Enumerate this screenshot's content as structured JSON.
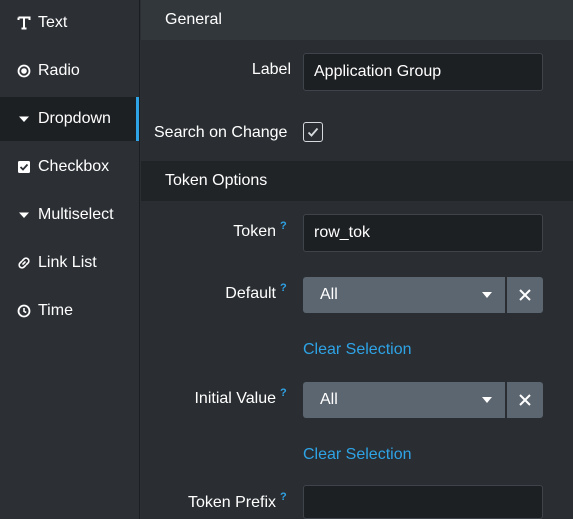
{
  "sidebar": {
    "items": [
      {
        "label": "Text",
        "icon": "text-icon"
      },
      {
        "label": "Radio",
        "icon": "radio-icon"
      },
      {
        "label": "Dropdown",
        "icon": "dropdown-icon",
        "active": true
      },
      {
        "label": "Checkbox",
        "icon": "checkbox-icon"
      },
      {
        "label": "Multiselect",
        "icon": "multiselect-icon"
      },
      {
        "label": "Link List",
        "icon": "link-icon"
      },
      {
        "label": "Time",
        "icon": "clock-icon"
      }
    ]
  },
  "general": {
    "header": "General",
    "label_label": "Label",
    "label_value": "Application Group",
    "search_on_change_label": "Search on Change",
    "search_on_change_checked": true
  },
  "token_options": {
    "header": "Token Options",
    "token_label": "Token",
    "token_value": "row_tok",
    "default_label": "Default",
    "default_value": "All",
    "default_clear": "Clear Selection",
    "initial_label": "Initial Value",
    "initial_value": "All",
    "initial_clear": "Clear Selection",
    "prefix_label": "Token Prefix",
    "prefix_value": "",
    "help_mark": "?"
  },
  "colors": {
    "accent": "#2ea3e6",
    "dropdown_bg": "#5c6670",
    "input_bg": "#1d2023"
  }
}
